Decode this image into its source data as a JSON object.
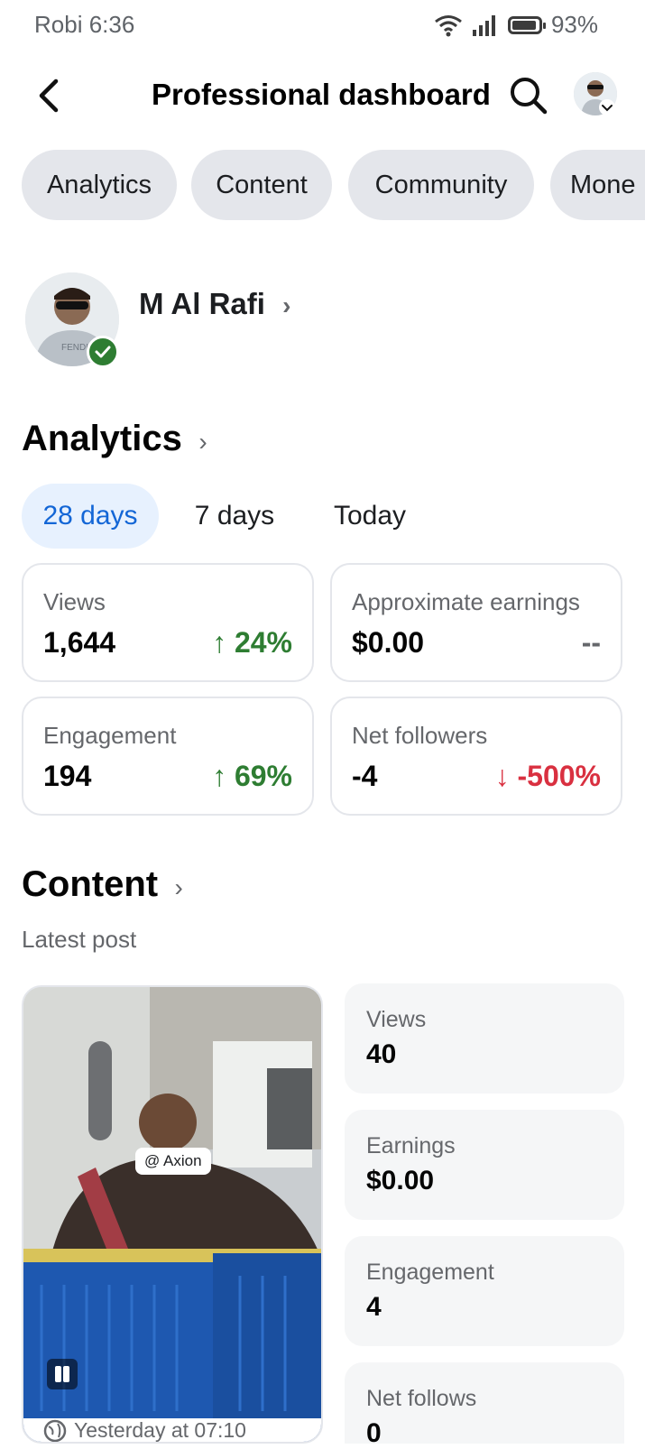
{
  "status_bar": {
    "carrier_time": "Robi 6:36",
    "battery": "93%"
  },
  "header": {
    "title": "Professional dashboard"
  },
  "chips": [
    "Analytics",
    "Content",
    "Community",
    "Mone"
  ],
  "profile": {
    "name": "M Al Rafi"
  },
  "analytics": {
    "title": "Analytics",
    "periods": [
      "28 days",
      "7 days",
      "Today"
    ],
    "active_period": "28 days",
    "cards": [
      {
        "label": "Views",
        "value": "1,644",
        "delta": "↑ 24%",
        "trend": "up"
      },
      {
        "label": "Approximate earnings",
        "value": "$0.00",
        "delta": "--",
        "trend": "neutral"
      },
      {
        "label": "Engagement",
        "value": "194",
        "delta": "↑ 69%",
        "trend": "up"
      },
      {
        "label": "Net followers",
        "value": "-4",
        "delta": "↓ -500%",
        "trend": "down"
      }
    ]
  },
  "content": {
    "title": "Content",
    "subtitle": "Latest post",
    "post": {
      "tag": "@ Axion",
      "timestamp": "Yesterday at 07:10"
    },
    "stats": [
      {
        "label": "Views",
        "value": "40"
      },
      {
        "label": "Earnings",
        "value": "$0.00"
      },
      {
        "label": "Engagement",
        "value": "4"
      },
      {
        "label": "Net follows",
        "value": "0"
      }
    ]
  },
  "colors": {
    "accent": "#1366d6",
    "positive": "#2e7d32",
    "negative": "#d93040",
    "chip_bg": "#e4e6eb"
  }
}
